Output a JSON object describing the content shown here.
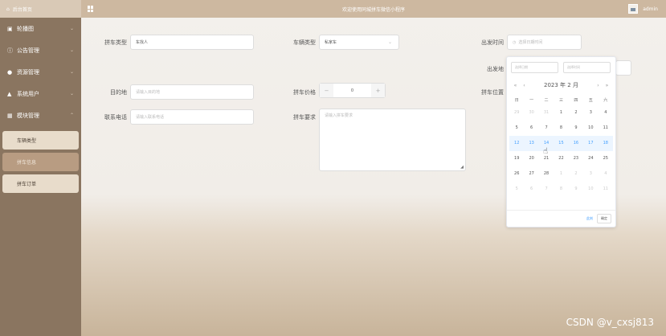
{
  "sidebar": {
    "home_label": "后台首页",
    "menu": [
      {
        "icon": "image-icon",
        "icon_glyph": "▣",
        "label": "轮播图",
        "chevron": "⌄"
      },
      {
        "icon": "info-icon",
        "icon_glyph": "ⓘ",
        "label": "公告管理",
        "chevron": "⌄"
      },
      {
        "icon": "location-icon",
        "icon_glyph": "●",
        "label": "资源管理",
        "chevron": "⌄"
      },
      {
        "icon": "user-icon",
        "icon_glyph": "▲",
        "label": "系统用户",
        "chevron": "⌄"
      },
      {
        "icon": "grid-icon",
        "icon_glyph": "▦",
        "label": "模块管理",
        "chevron": "⌃"
      }
    ],
    "submenu": [
      {
        "label": "车辆类型"
      },
      {
        "label": "拼车信息"
      },
      {
        "label": "拼车订单"
      }
    ]
  },
  "header": {
    "title": "欢迎使用同城拼车微信小程序",
    "user": "admin"
  },
  "form": {
    "carpool_type": {
      "label": "拼车类型",
      "value": "车找人"
    },
    "vehicle_type": {
      "label": "车辆类型",
      "value": "私家车"
    },
    "depart_time": {
      "label": "出发时间",
      "placeholder": "选择日期时间"
    },
    "depart_place": {
      "label": "出发地"
    },
    "destination": {
      "label": "目的地",
      "placeholder": "请输入目的地"
    },
    "price": {
      "label": "拼车价格",
      "value": "0",
      "minus": "−",
      "plus": "+"
    },
    "carpool_position": {
      "label": "拼车位置"
    },
    "phone": {
      "label": "联系电话",
      "placeholder": "请输入联系电话"
    },
    "requirements": {
      "label": "拼车要求",
      "placeholder": "请输入拼车要求"
    }
  },
  "datepicker": {
    "date_placeholder": "选择日期",
    "time_placeholder": "选择时间",
    "nav": {
      "prev_year": "«",
      "prev_month": "‹",
      "next_month": "›",
      "next_year": "»"
    },
    "year_month": "2023 年 2 月",
    "weekdays": [
      "日",
      "一",
      "二",
      "三",
      "四",
      "五",
      "六"
    ],
    "days": [
      {
        "d": "29",
        "m": "other"
      },
      {
        "d": "30",
        "m": "other"
      },
      {
        "d": "31",
        "m": "other"
      },
      {
        "d": "1"
      },
      {
        "d": "2"
      },
      {
        "d": "3"
      },
      {
        "d": "4"
      },
      {
        "d": "5"
      },
      {
        "d": "6"
      },
      {
        "d": "7"
      },
      {
        "d": "8"
      },
      {
        "d": "9"
      },
      {
        "d": "10"
      },
      {
        "d": "11"
      },
      {
        "d": "12",
        "m": "sel"
      },
      {
        "d": "13",
        "m": "sel"
      },
      {
        "d": "14",
        "m": "sel"
      },
      {
        "d": "15",
        "m": "sel"
      },
      {
        "d": "16",
        "m": "sel"
      },
      {
        "d": "17",
        "m": "sel"
      },
      {
        "d": "18",
        "m": "sel"
      },
      {
        "d": "19"
      },
      {
        "d": "20"
      },
      {
        "d": "21"
      },
      {
        "d": "22"
      },
      {
        "d": "23"
      },
      {
        "d": "24"
      },
      {
        "d": "25"
      },
      {
        "d": "26"
      },
      {
        "d": "27"
      },
      {
        "d": "28"
      },
      {
        "d": "1",
        "m": "other"
      },
      {
        "d": "2",
        "m": "other"
      },
      {
        "d": "3",
        "m": "other"
      },
      {
        "d": "4",
        "m": "other"
      },
      {
        "d": "5",
        "m": "other"
      },
      {
        "d": "6",
        "m": "other"
      },
      {
        "d": "7",
        "m": "other"
      },
      {
        "d": "8",
        "m": "other"
      },
      {
        "d": "9",
        "m": "other"
      },
      {
        "d": "10",
        "m": "other"
      },
      {
        "d": "11",
        "m": "other"
      }
    ],
    "now_label": "此刻",
    "ok_label": "确定"
  },
  "watermark": "CSDN @v_cxsj813"
}
